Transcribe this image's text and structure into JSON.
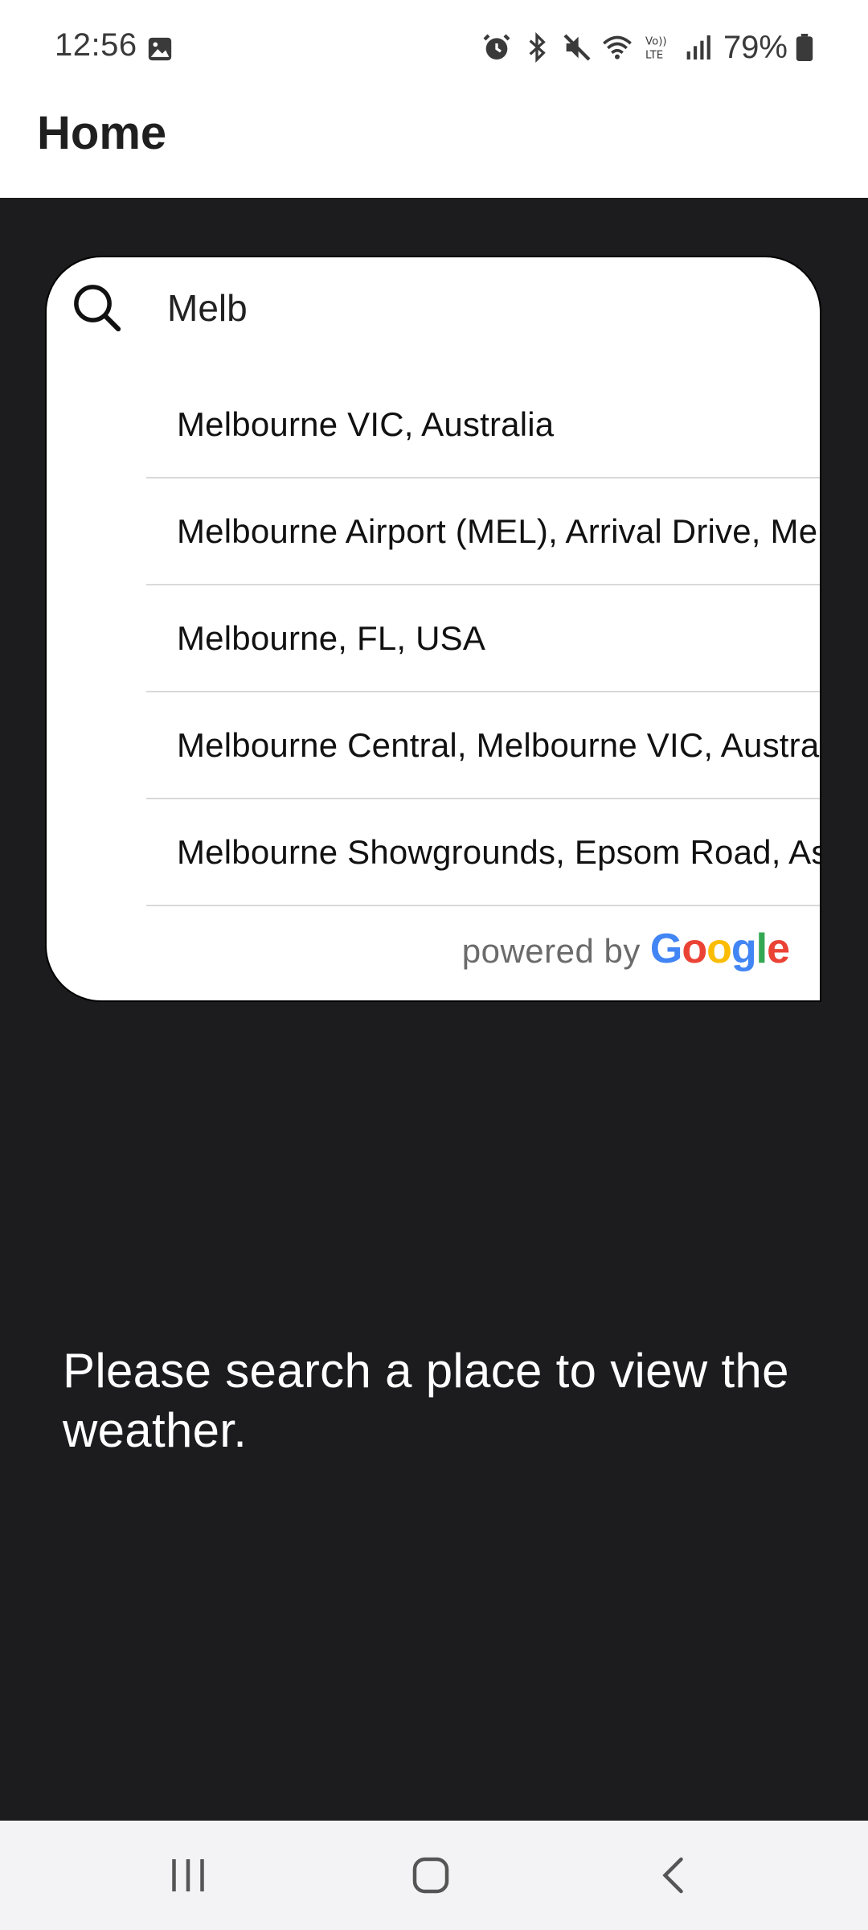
{
  "status_bar": {
    "time": "12:56",
    "battery_percent": "79%",
    "icons": [
      "gallery-icon",
      "alarm-icon",
      "bluetooth-icon",
      "mute-icon",
      "wifi-icon",
      "volte-icon",
      "signal-icon",
      "battery-icon"
    ]
  },
  "app_bar": {
    "title": "Home"
  },
  "search": {
    "value": "Melb",
    "suggestions": [
      "Melbourne VIC, Australia",
      "Melbourne Airport (MEL), Arrival Drive, Melbourne Airport VIC, Australia",
      "Melbourne, FL, USA",
      "Melbourne Central, Melbourne VIC, Australia",
      "Melbourne Showgrounds, Epsom Road, Ascot Vale VIC, Australia"
    ],
    "powered_by": "powered by",
    "google": {
      "letters": [
        "G",
        "o",
        "o",
        "g",
        "l",
        "e"
      ],
      "colors": [
        "#4285F4",
        "#EA4335",
        "#FBBC05",
        "#4285F4",
        "#34A853",
        "#EA4335"
      ]
    }
  },
  "main": {
    "empty_message": "Please search a place to view the weather."
  },
  "nav_bar": {
    "buttons": [
      "recent-apps",
      "home",
      "back"
    ]
  },
  "colors": {
    "background": "#1c1c1e",
    "card": "#ffffff",
    "divider": "#d9d9d9"
  }
}
